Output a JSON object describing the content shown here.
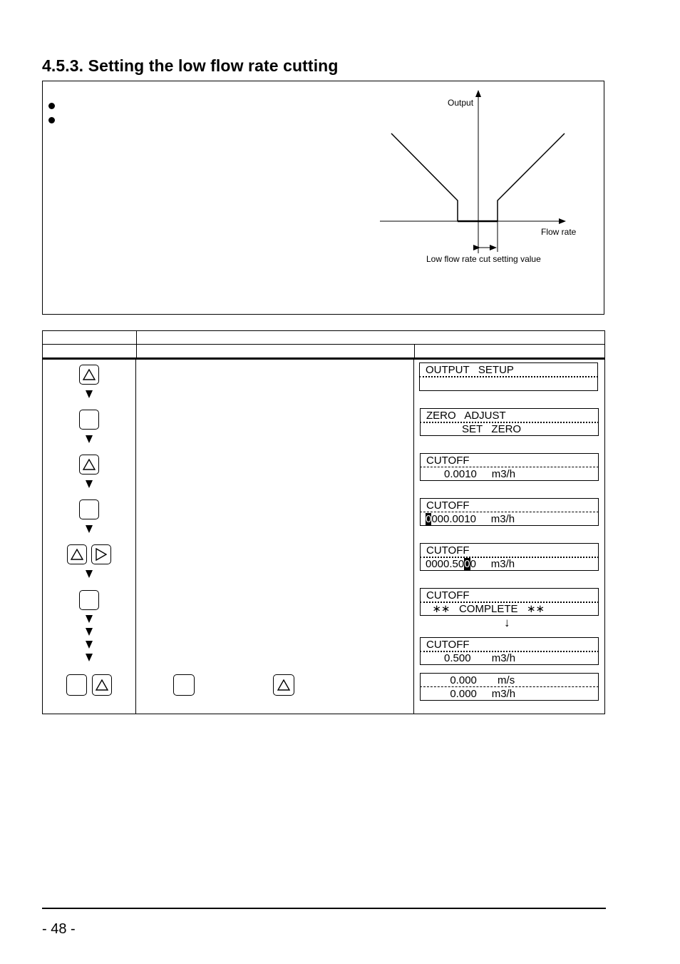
{
  "page": {
    "section_title": "4.5.3. Setting the low flow rate cutting",
    "page_number": "- 48 -"
  },
  "info_box": {
    "bullets": [
      "",
      ""
    ]
  },
  "diagram": {
    "y_axis_label": "Output",
    "x_axis_label": "Flow rate",
    "annotation": "Low flow rate cut setting value"
  },
  "procedure_table": {
    "header_row1": [
      "",
      ""
    ],
    "header_row2": [
      "",
      "",
      ""
    ],
    "steps": [
      {
        "keys": [
          "up-key"
        ],
        "display": {
          "line1": "OUTPUT   SETUP",
          "line2": ""
        }
      },
      {
        "keys": [
          "enter-key"
        ],
        "display": {
          "line1": "ZERO   ADJUST",
          "line2": "            SET   ZERO"
        }
      },
      {
        "keys": [
          "up-key"
        ],
        "display": {
          "line1": "CUTOFF",
          "line2": "      0.0010     m3/h"
        }
      },
      {
        "keys": [
          "enter-key"
        ],
        "display": {
          "line1": "CUTOFF",
          "line2_cursor": "0",
          "line2_rest": "000.0010     m3/h"
        }
      },
      {
        "keys": [
          "up-key",
          "right-key"
        ],
        "display": {
          "line1": "CUTOFF",
          "line2_pre": "0000.50",
          "line2_cursor": "0",
          "line2_rest": "0     m3/h"
        }
      },
      {
        "keys": [
          "enter-key"
        ],
        "display": {
          "line1": "CUTOFF",
          "line2": "  ∗∗   COMPLETE   ∗∗"
        },
        "next_arrow": "↓",
        "then_display": {
          "line1": "CUTOFF",
          "line2": "      0.500       m3/h"
        }
      },
      {
        "keys": [
          "enter-key",
          "up-key"
        ],
        "inline_keys": [
          "enter-key",
          "up-key"
        ],
        "display": {
          "line1": "        0.000       m/s",
          "line2": "        0.000     m3/h"
        }
      }
    ]
  }
}
